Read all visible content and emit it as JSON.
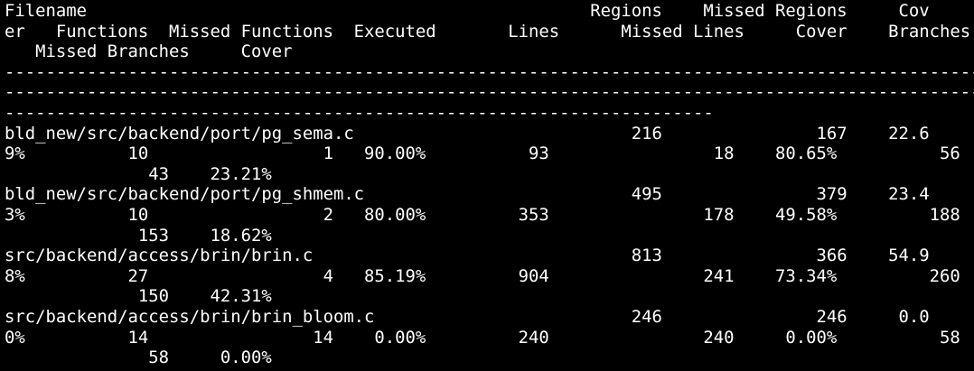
{
  "colors": {
    "background": "#000000",
    "foreground": "#ffffff"
  },
  "terminal": {
    "lines": [
      "Filename                                                 Regions    Missed Regions     Cov",
      "er   Functions  Missed Functions  Executed       Lines      Missed Lines     Cover    Branches",
      "   Missed Branches     Cover",
      "-----------------------------------------------------------------------------------------------",
      "-----------------------------------------------------------------------------------------------",
      "---------------------------------------------------------------------",
      "bld_new/src/backend/port/pg_sema.c                           216               167    22.6",
      "9%          10                 1   90.00%          93                18    80.65%          56",
      "              43    23.21%",
      "bld_new/src/backend/port/pg_shmem.c                          495               379    23.4",
      "3%          10                 2   80.00%         353               178    49.58%         188",
      "             153    18.62%",
      "src/backend/access/brin/brin.c                               813               366    54.9",
      "8%          27                 4   85.19%         904               241    73.34%         260",
      "             150    42.31%",
      "src/backend/access/brin/brin_bloom.c                         246               246     0.0",
      "0%          14                14    0.00%         240               240     0.00%          58",
      "              58     0.00%"
    ]
  }
}
